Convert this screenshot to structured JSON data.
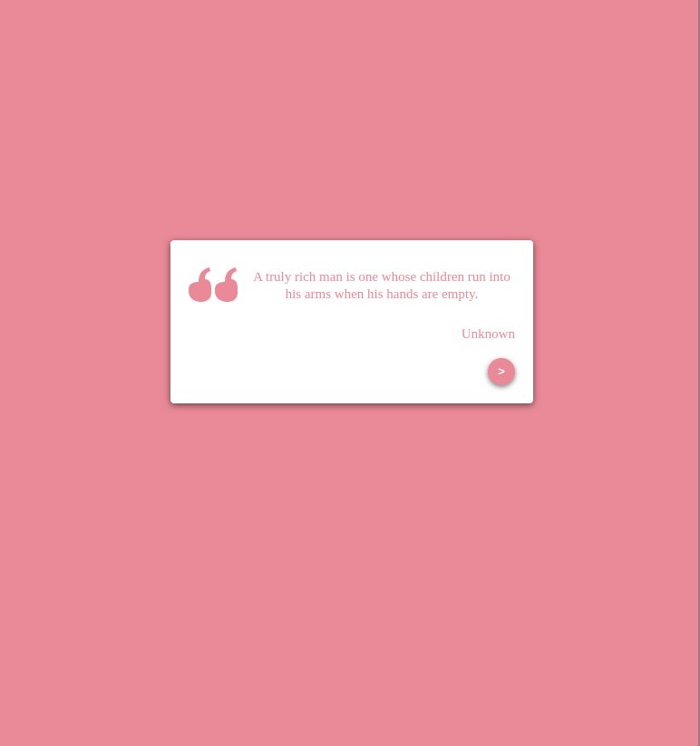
{
  "theme": {
    "background": "#ea8a98",
    "card_background": "#ffffff",
    "accent": "#ea8a98"
  },
  "quote_card": {
    "icon": "quote-left-icon",
    "text": "A truly rich man is one whose children run into his arms when his hands are empty.",
    "author": "Unknown",
    "next_button_label": ">"
  }
}
